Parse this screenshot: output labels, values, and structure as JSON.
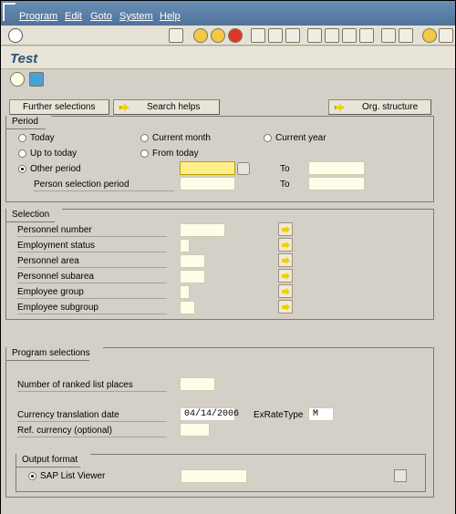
{
  "menu": {
    "items": [
      "Program",
      "Edit",
      "Goto",
      "System",
      "Help"
    ]
  },
  "toolbar": {
    "command_value": ""
  },
  "title": "Test",
  "buttons": {
    "further_selections": "Further selections",
    "search_helps": "Search helps",
    "org_structure": "Org. structure"
  },
  "period": {
    "group_title": "Period",
    "today": "Today",
    "current_month": "Current month",
    "current_year": "Current year",
    "up_to_today": "Up to today",
    "from_today": "From today",
    "other_period": "Other period",
    "person_selection_period": "Person selection period",
    "to": "To",
    "to2": "To"
  },
  "selection": {
    "group_title": "Selection",
    "labels": [
      "Personnel number",
      "Employment status",
      "Personnel area",
      "Personnel subarea",
      "Employee group",
      "Employee subgroup"
    ]
  },
  "program_selections": {
    "group_title": "Program selections",
    "ranked_list": "Number of ranked list places",
    "currency_date_label": "Currency translation date",
    "currency_date_value": "04/14/2006",
    "exrate_label": "ExRateType",
    "exrate_value": "M",
    "ref_currency": "Ref. currency (optional)"
  },
  "output_format": {
    "group_title": "Output format",
    "option": "SAP List Viewer"
  }
}
